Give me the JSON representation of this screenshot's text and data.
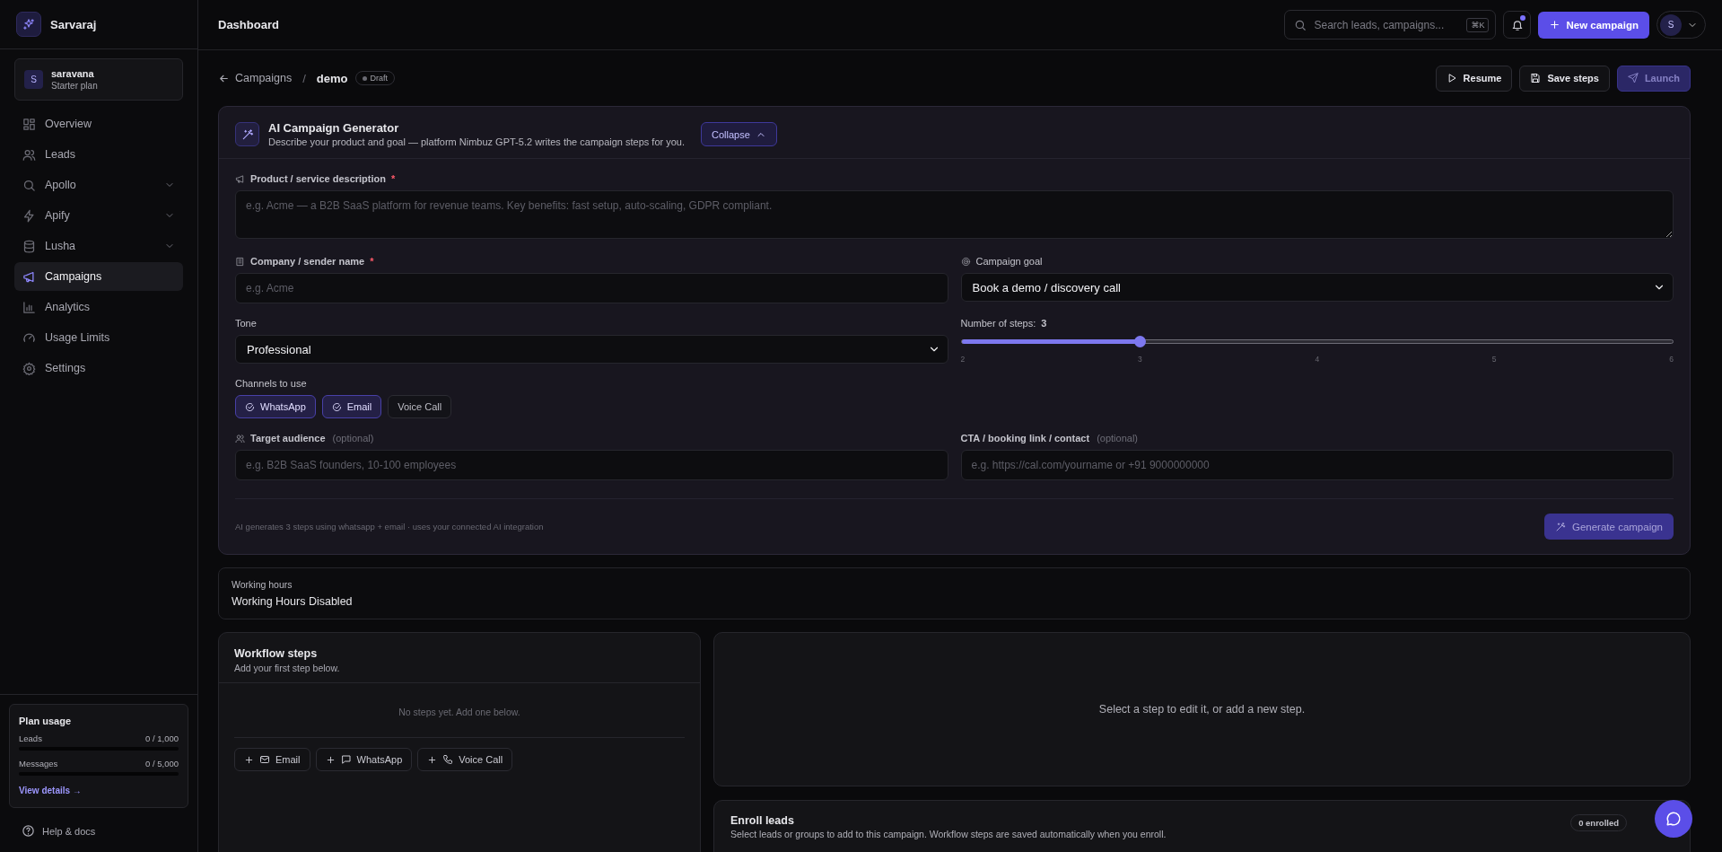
{
  "brand": {
    "name": "Sarvaraj"
  },
  "account": {
    "initial": "S",
    "name": "saravana",
    "plan": "Starter plan"
  },
  "sidebar": {
    "items": [
      {
        "label": "Overview",
        "expandable": false,
        "selected": false
      },
      {
        "label": "Leads",
        "expandable": false,
        "selected": false
      },
      {
        "label": "Apollo",
        "expandable": true,
        "selected": false
      },
      {
        "label": "Apify",
        "expandable": true,
        "selected": false
      },
      {
        "label": "Lusha",
        "expandable": true,
        "selected": false
      },
      {
        "label": "Campaigns",
        "expandable": false,
        "selected": true
      },
      {
        "label": "Analytics",
        "expandable": false,
        "selected": false
      },
      {
        "label": "Usage Limits",
        "expandable": false,
        "selected": false
      },
      {
        "label": "Settings",
        "expandable": false,
        "selected": false
      }
    ]
  },
  "plan_usage": {
    "title": "Plan usage",
    "meters": [
      {
        "label": "Leads",
        "reading": "0 / 1,000",
        "level": 0
      },
      {
        "label": "Messages",
        "reading": "0 / 5,000",
        "level": 0
      }
    ],
    "link": "View details →"
  },
  "help": "Help & docs",
  "header": {
    "title": "Dashboard",
    "search": {
      "placeholder": "Search leads, campaigns...",
      "shortcut": "⌘K"
    },
    "notification_dot": true,
    "new_button": "New campaign",
    "avatar": "S"
  },
  "breadcrumb": {
    "back": "Campaigns",
    "separator": "/",
    "current": "demo",
    "status": "Draft"
  },
  "actions": [
    {
      "label": "Resume",
      "kind": "play",
      "disabled": false
    },
    {
      "label": "Save steps",
      "kind": "save",
      "disabled": false
    },
    {
      "label": "Launch",
      "kind": "send",
      "disabled": true
    }
  ],
  "generator": {
    "title": "AI Campaign Generator",
    "subtitle": "Describe your product and goal — platform Nimbuz GPT-5.2 writes the campaign steps for you.",
    "collapse": "Collapse",
    "description": {
      "label": "Product / service description",
      "required_mark": "*",
      "placeholder": "e.g. Acme — a B2B SaaS platform for revenue teams. Key benefits: fast setup, auto-scaling, GDPR compliant."
    },
    "company": {
      "label": "Company / sender name",
      "required_mark": "*",
      "placeholder": "e.g. Acme"
    },
    "goal": {
      "label": "Campaign goal",
      "value": "Book a demo / discovery call"
    },
    "tone": {
      "label": "Tone",
      "value": "Professional"
    },
    "steps": {
      "label": "Number of steps:",
      "value": "3",
      "level": 0.25,
      "ticks": [
        "2",
        "3",
        "4",
        "5",
        "6"
      ]
    },
    "channels": {
      "label": "Channels to use",
      "options": [
        {
          "label": "WhatsApp",
          "selected": true
        },
        {
          "label": "Email",
          "selected": true
        },
        {
          "label": "Voice Call",
          "selected": false
        }
      ]
    },
    "audience": {
      "label": "Target audience",
      "optional": "(optional)",
      "placeholder": "e.g. B2B SaaS founders, 10-100 employees"
    },
    "cta": {
      "label": "CTA / booking link / contact",
      "optional": "(optional)",
      "placeholder": "e.g. https://cal.com/yourname or +91 9000000000"
    },
    "note": "AI generates 3 steps using whatsapp + email · uses your connected AI integration",
    "generate": {
      "label": "Generate campaign",
      "disabled": true
    }
  },
  "working_hours": {
    "label": "Working hours",
    "value": "Working Hours Disabled"
  },
  "workflow": {
    "title": "Workflow steps",
    "subtitle": "Add your first step below.",
    "empty": "No steps yet. Add one below.",
    "add_buttons": [
      {
        "label": "Email",
        "kind": "email"
      },
      {
        "label": "WhatsApp",
        "kind": "chat"
      },
      {
        "label": "Voice Call",
        "kind": "phone"
      }
    ]
  },
  "editor": {
    "message": "Select a step to edit it, or add a new step."
  },
  "enroll": {
    "title": "Enroll leads",
    "subtitle": "Select leads or groups to add to this campaign. Workflow steps are saved automatically when you enroll.",
    "badge": "0 enrolled"
  }
}
